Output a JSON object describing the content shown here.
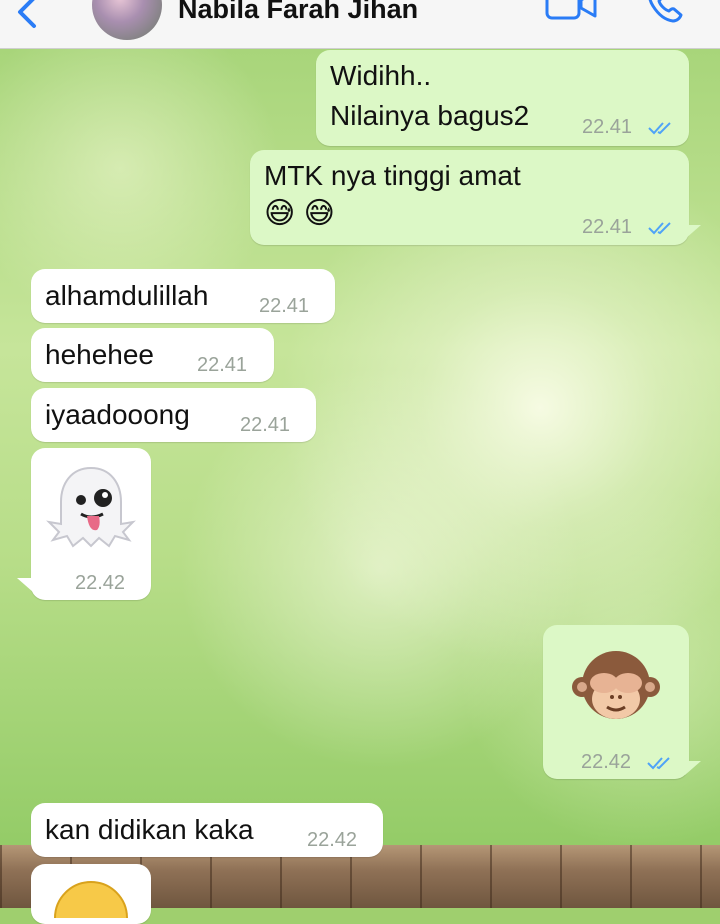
{
  "header": {
    "contact_name": "Nabila Farah Jihan"
  },
  "messages": [
    {
      "direction": "out",
      "lines": [
        "Widihh..",
        "Nilainya bagus2"
      ],
      "time": "22.41",
      "status": "read"
    },
    {
      "direction": "out",
      "lines": [
        "MTK nya tinggi amat"
      ],
      "emoji": "😅 😅",
      "time": "22.41",
      "status": "read"
    },
    {
      "direction": "in",
      "lines": [
        "alhamdulillah"
      ],
      "time": "22.41"
    },
    {
      "direction": "in",
      "lines": [
        "hehehee"
      ],
      "time": "22.41"
    },
    {
      "direction": "in",
      "lines": [
        "iyaadooong"
      ],
      "time": "22.41"
    },
    {
      "direction": "in",
      "emoji": "ghost",
      "time": "22.42"
    },
    {
      "direction": "out",
      "emoji": "see-no-evil-monkey",
      "time": "22.42",
      "status": "read"
    },
    {
      "direction": "in",
      "lines": [
        "kan didikan kaka"
      ],
      "time": "22.42"
    }
  ],
  "colors": {
    "outgoing_bubble": "#dcf8c6",
    "incoming_bubble": "#ffffff",
    "accent": "#2a7cf6",
    "read_ticks": "#4fa3f7"
  }
}
